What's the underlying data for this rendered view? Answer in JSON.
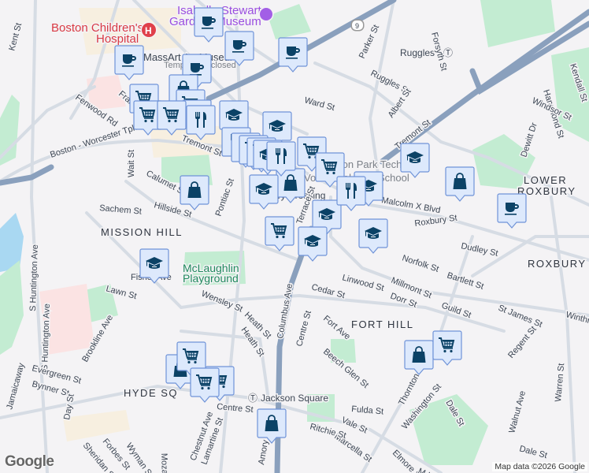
{
  "map": {
    "attribution": "Map data ©2026 Google",
    "logo": "Google",
    "colors": {
      "background": "#f4f3f5",
      "road": "#d3d9e2",
      "highway": "#8aa0bd",
      "park": "#c3ecd2",
      "marker_fill": "#dde9fc",
      "marker_border": "#6f93d8",
      "icon": "#0b4266"
    },
    "areas": [
      "MISSION HILL",
      "LOWER",
      "ROXBURY",
      "ROXBURY",
      "FORT HILL",
      "HYDE SQ"
    ],
    "pois": {
      "hospital": "Boston Children's",
      "hospital2": "Hospital",
      "museum": "Isabella Stewart",
      "museum2": "Gardner Museum",
      "massart": "MassArt Art Museum",
      "massart_status": "Temporarily closed",
      "playground": "McLaughlin",
      "playground2": "Playground",
      "school": "Madison Park Technical",
      "school2": "Vocational High School",
      "ruggles": "Ruggles",
      "roxbury_crossing": "Roxbury Crossing",
      "jackson": "Jackson Square",
      "route": "9"
    },
    "streets": [
      "Kent St",
      "Brookline Ave",
      "Fenwood Rd",
      "Francis St",
      "Boston - Worcester Tpke",
      "Tremont St",
      "Wait St",
      "Calumet St",
      "Pontiac St",
      "Sachem St",
      "Hillside St",
      "Jamaicaway",
      "S Huntington Ave",
      "Parker St",
      "Forsyth St",
      "Ruggles St",
      "Ward St",
      "Albert St",
      "Tremont St",
      "Hammond St",
      "Kendall St",
      "Windsor St",
      "Dewitt Dr",
      "Malcolm X Blvd",
      "Roxbury St",
      "Dudley St",
      "Norfolk St",
      "Bartlett St",
      "Linwood St",
      "Millmont St",
      "Dorr St",
      "Cedar St",
      "Guild St",
      "St James St",
      "Winthrop St",
      "Regent St",
      "Warren St",
      "Fort Ave",
      "Centre St",
      "Beech Glen St",
      "Thornton St",
      "Washington St",
      "Dale St",
      "Walnut Ave",
      "Dale St",
      "Fulda St",
      "Vale St",
      "Marcella St",
      "Ritchie St",
      "Elmore St",
      "M.L.K. Blvd",
      "Columbus Ave",
      "Heath St",
      "Heath St",
      "Lawn St",
      "Wensley St",
      "Fisher Ave",
      "Evergreen St",
      "Bynner St",
      "Day St",
      "Centre St",
      "Sheridan St",
      "Forbes St",
      "Wyman St",
      "Mozart St",
      "Chestnut Ave",
      "Amory St",
      "S Huntington Ave",
      "Lamartine St",
      "Terrace St"
    ],
    "markers": [
      "coffee",
      "coffee",
      "coffee",
      "coffee",
      "coffee",
      "coffee",
      "bag",
      "cart",
      "cart",
      "cart",
      "restaurant",
      "education",
      "education",
      "restaurant",
      "restaurant",
      "cart",
      "cart",
      "education",
      "bag",
      "restaurant",
      "cart",
      "education",
      "education",
      "education",
      "education",
      "education",
      "bag",
      "cart",
      "education",
      "cart",
      "bag",
      "bag",
      "cart",
      "bag",
      "cart",
      "bag"
    ]
  }
}
